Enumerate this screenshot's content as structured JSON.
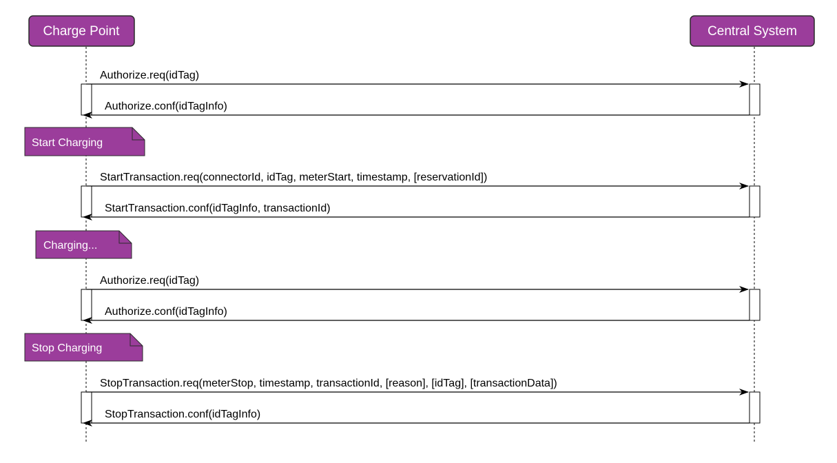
{
  "colors": {
    "participant_fill": "#9b3d9b",
    "participant_stroke": "#2b2b2b",
    "note_fill": "#9b3d9b",
    "note_text": "#ffffff",
    "line": "#000000",
    "background": "#ffffff"
  },
  "participants": [
    {
      "id": "charge_point",
      "label": "Charge Point"
    },
    {
      "id": "central_system",
      "label": "Central System"
    }
  ],
  "blocks": [
    {
      "note": null,
      "request": "Authorize.req(idTag)",
      "response": "Authorize.conf(idTagInfo)"
    },
    {
      "note": "Start Charging",
      "request": "StartTransaction.req(connectorId, idTag, meterStart, timestamp, [reservationId])",
      "response": "StartTransaction.conf(idTagInfo, transactionId)"
    },
    {
      "note": "Charging...",
      "request": "Authorize.req(idTag)",
      "response": "Authorize.conf(idTagInfo)"
    },
    {
      "note": "Stop Charging",
      "request": "StopTransaction.req(meterStop, timestamp, transactionId, [reason], [idTag], [transactionData])",
      "response": "StopTransaction.conf(idTagInfo)"
    }
  ]
}
